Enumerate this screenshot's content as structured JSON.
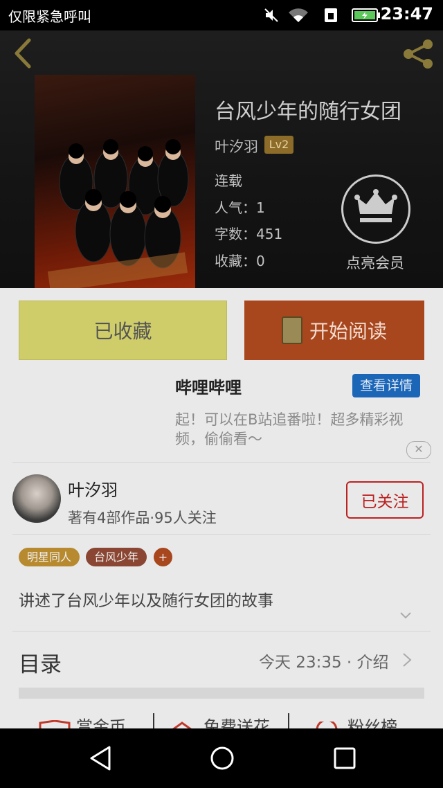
{
  "status_bar": {
    "carrier": "仅限紧急呼叫",
    "time": "23:47"
  },
  "book": {
    "title": "台风少年的随行女团",
    "author": "叶汐羽",
    "level": "Lv2",
    "status": "连载",
    "popularity_label": "人气：1",
    "wordcount_label": "字数：451",
    "favorites_label": "收藏：0",
    "vip_label": "点亮会员"
  },
  "actions": {
    "favorited_label": "已收藏",
    "read_label": "开始阅读"
  },
  "ad": {
    "title": "哔哩哔哩",
    "detail_button": "查看详情",
    "desc_line1": "起！可以在B站追番啦！超多精彩视",
    "desc_line2": "频，偷偷看～"
  },
  "author_card": {
    "name": "叶汐羽",
    "stats": "著有4部作品·95人关注",
    "follow_label": "已关注"
  },
  "tags": [
    {
      "label": "明星同人",
      "color": "#b78a2f"
    },
    {
      "label": "台风少年",
      "color": "#8a4632"
    },
    {
      "label": "+",
      "color": "#a8461d"
    }
  ],
  "synopsis": "讲述了台风少年以及随行女团的故事",
  "toc": {
    "label": "目录",
    "meta": "今天 23:35 · 介绍"
  },
  "bottom_tabs": [
    {
      "label": "赏金币"
    },
    {
      "label": "免费送花"
    },
    {
      "label": "粉丝榜"
    }
  ],
  "icons": {
    "back": "back-arrow-icon",
    "share": "share-icon",
    "crown": "crown-icon"
  }
}
